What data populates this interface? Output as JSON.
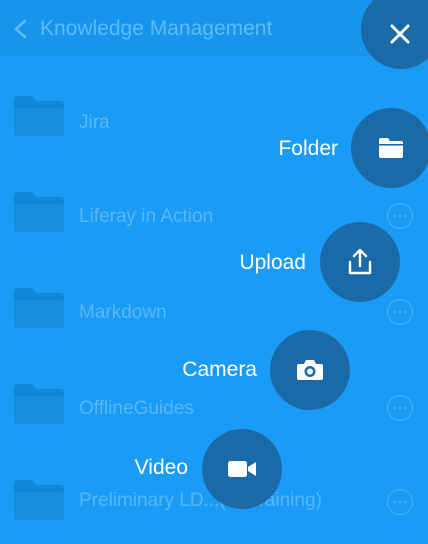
{
  "header": {
    "title": "Knowledge Management",
    "back_icon": "chevron-left-icon",
    "close_icon": "close-icon"
  },
  "folders": [
    {
      "name": "Jira",
      "icon": "folder-icon",
      "has_menu": false
    },
    {
      "name": "Liferay in Action",
      "icon": "folder-icon",
      "has_menu": true
    },
    {
      "name": "Markdown",
      "icon": "folder-icon",
      "has_menu": true
    },
    {
      "name": "OfflineGuides",
      "icon": "folder-icon",
      "has_menu": true
    },
    {
      "name": "Preliminary LD...(for training)",
      "icon": "folder-icon",
      "has_menu": true
    }
  ],
  "actions": [
    {
      "label": "Folder",
      "icon": "folder-icon"
    },
    {
      "label": "Upload",
      "icon": "upload-icon"
    },
    {
      "label": "Camera",
      "icon": "camera-icon"
    },
    {
      "label": "Video",
      "icon": "video-camera-icon"
    }
  ],
  "colors": {
    "overlay_background": "#1a9bf5",
    "app_bar": "#1794ec",
    "fab": "#1a6aa8",
    "faded_text": "#56b8f9"
  }
}
